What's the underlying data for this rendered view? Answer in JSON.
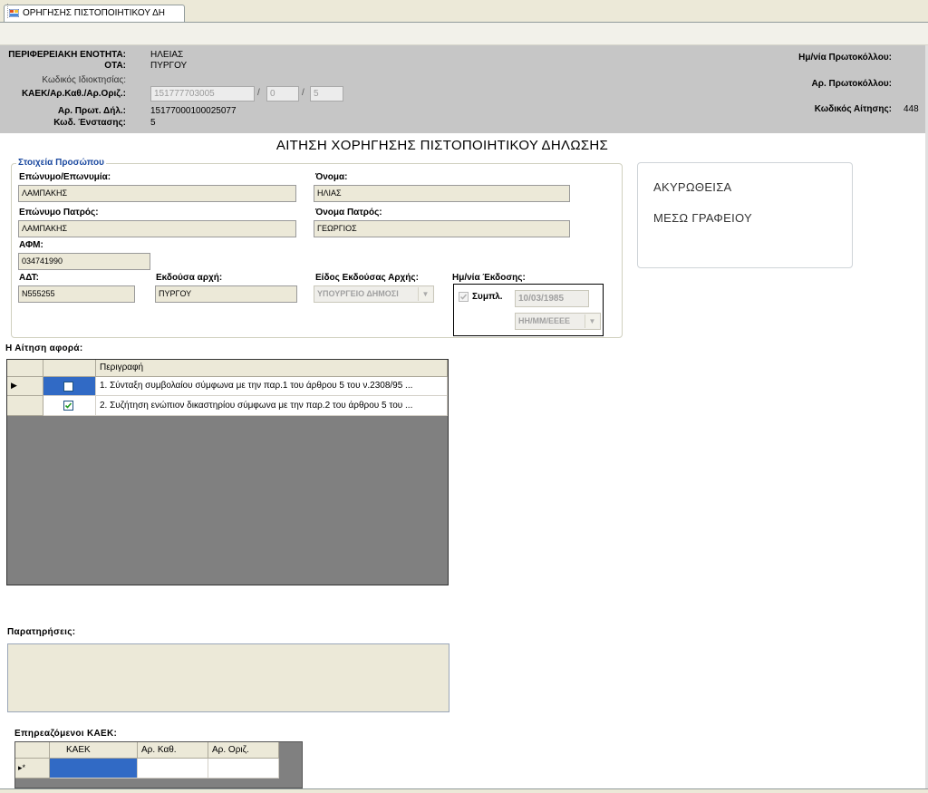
{
  "tab": {
    "title": "ΟΡΗΓΗΣΗΣ ΠΙΣΤΟΠΟΙΗΤΙΚΟΥ ΔΗ"
  },
  "header": {
    "perifereiaki_label": "ΠΕΡΙΦΕΡΕΙΑΚΗ ΕΝΟΤΗΤΑ:",
    "perifereiaki_value": "ΗΛΕΙΑΣ",
    "ota_label": "ΟΤΑ:",
    "ota_value": "ΠΥΡΓΟΥ",
    "kodikos_idioktisias_label": "Κωδικός Ιδιοκτησίας:",
    "kaek_label": "ΚΑΕΚ/Αρ.Καθ./Αρ.Οριζ.:",
    "kaek_value": "151777703005",
    "ar_kath_value": "0",
    "ar_oriz_value": "5",
    "slash": "/",
    "ar_prot_dil_label": "Αρ. Πρωτ. Δήλ.:",
    "ar_prot_dil_value": "15177000100025077",
    "kod_enstasis_label": "Κωδ. Ένστασης:",
    "kod_enstasis_value": "5",
    "im_protokollou_label": "Ημ/νία Πρωτοκόλλου:",
    "ar_protokollou_label": "Αρ. Πρωτοκόλλου:",
    "kodikos_aitisis_label": "Κωδικός Αίτησης:",
    "kodikos_aitisis_value": "448"
  },
  "form_title": "ΑΙΤΗΣΗ ΧΟΡΗΓΗΣΗΣ ΠΙΣΤΟΠΟΙΗΤΙΚΟΥ ΔΗΛΩΣΗΣ",
  "person": {
    "legend": "Στοιχεία Προσώπου",
    "surname_label": "Επώνυμο/Επωνυμία:",
    "surname_value": "ΛΑΜΠΑΚΗΣ",
    "name_label": "Όνομα:",
    "name_value": "ΗΛΙΑΣ",
    "father_surname_label": "Επώνυμο Πατρός:",
    "father_surname_value": "ΛΑΜΠΑΚΗΣ",
    "father_name_label": "Όνομα Πατρός:",
    "father_name_value": "ΓΕΩΡΓΙΟΣ",
    "afm_label": "ΑΦΜ:",
    "afm_value": "034741990",
    "adt_label": "ΑΔΤ:",
    "adt_value": "N555255",
    "issuing_authority_label": "Εκδούσα αρχή:",
    "issuing_authority_value": "ΠΥΡΓΟΥ",
    "authority_type_label": "Είδος Εκδούσας Αρχής:",
    "authority_type_value": "ΥΠΟΥΡΓΕΙΟ ΔΗΜΟΣΙ",
    "issue_date_label": "Ημ/νία Έκδοσης:",
    "filled_label": "Συμπλ.",
    "issue_date_value": "10/03/1985",
    "date_format_value": "ΗΗ/ΜΜ/ΕΕΕΕ"
  },
  "status": {
    "line1": "ΑΚΥΡΩΘΕΙΣΑ",
    "line2": "ΜΕΣΩ ΓΡΑΦΕΙΟΥ"
  },
  "request": {
    "label": "Η Αίτηση αφορά:",
    "column_description": "Περιγραφή",
    "rows": [
      {
        "checked": false,
        "description": "1. Σύνταξη συμβολαίου σύμφωνα με την παρ.1 του άρθρου 5 του ν.2308/95 ..."
      },
      {
        "checked": true,
        "description": "2. Συζήτηση ενώπιον δικαστηρίου σύμφωνα με την παρ.2 του άρθρου 5 του ..."
      }
    ]
  },
  "remarks": {
    "label": "Παρατηρήσεις:",
    "value": ""
  },
  "affected": {
    "label": "Επηρεαζόμενοι ΚΑΕΚ:",
    "columns": [
      "ΚΑΕΚ",
      "Αρ. Καθ.",
      "Αρ. Οριζ."
    ],
    "new_row_marker": "▸*"
  },
  "colors": {
    "header_bg": "#c6c6c6",
    "field_bg": "#ece9d8",
    "legend": "#1c4aa0",
    "selection": "#316ac5"
  }
}
